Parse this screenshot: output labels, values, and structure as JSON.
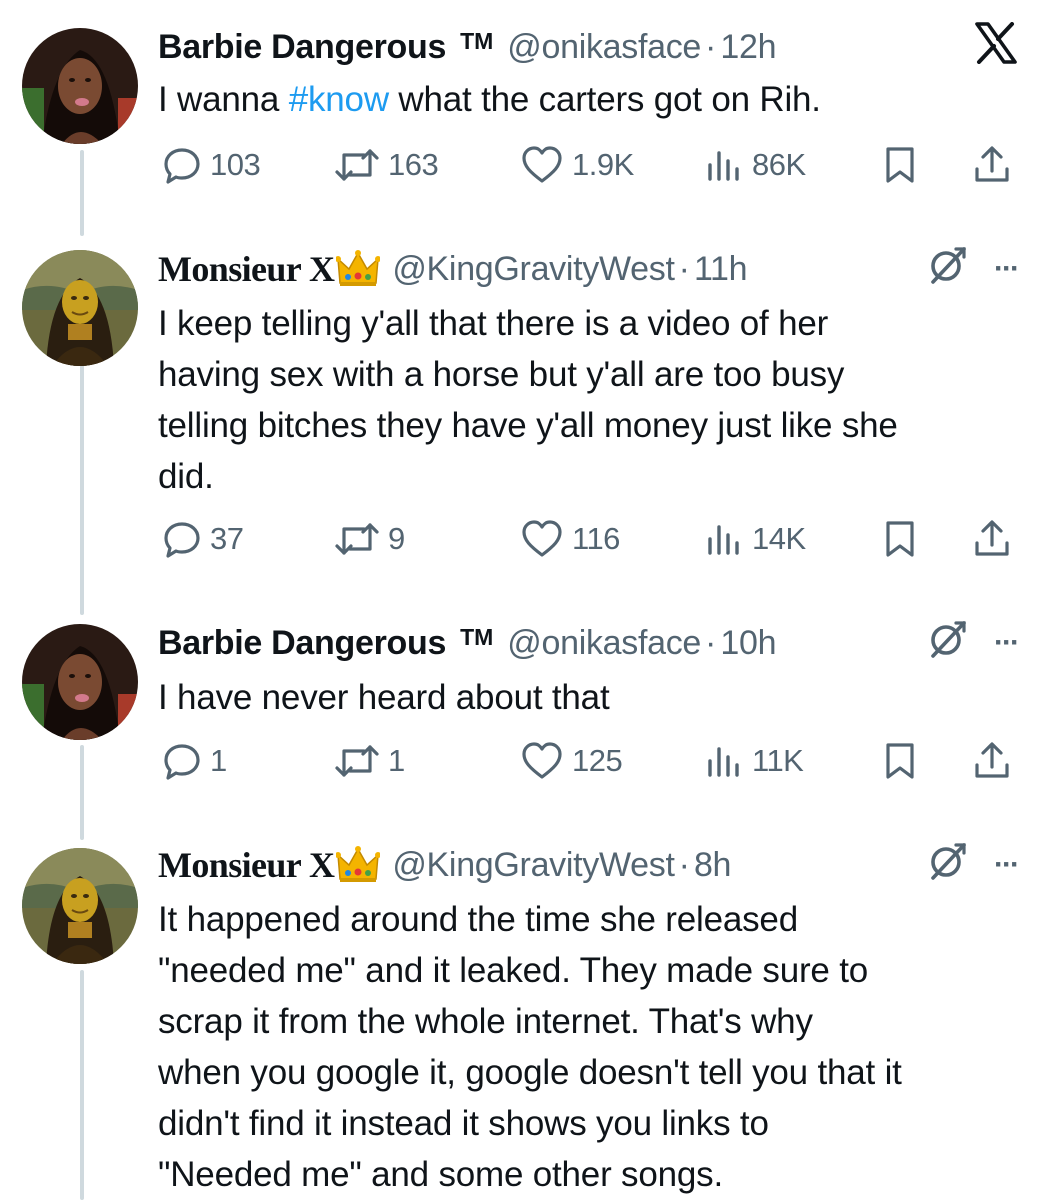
{
  "tweets": [
    {
      "name": "Barbie Dangerous",
      "badge": "TM",
      "handle": "@onikasface",
      "separator": "·",
      "time": "12h",
      "text_before": "I wanna ",
      "hashtag": "#know",
      "text_after": " what the carters got on Rih.",
      "replies": "103",
      "reposts": "163",
      "likes": "1.9K",
      "views": "86K"
    },
    {
      "name": "Monsieur X",
      "handle": "@KingGravityWest",
      "separator": "·",
      "time": "11h",
      "lines": [
        "I keep telling y'all that there is a video of her",
        "having sex with a horse but y'all are too busy",
        "telling bitches they have y'all money just like she",
        "did."
      ],
      "replies": "37",
      "reposts": "9",
      "likes": "116",
      "views": "14K"
    },
    {
      "name": "Barbie Dangerous",
      "badge": "TM",
      "handle": "@onikasface",
      "separator": "·",
      "time": "10h",
      "text": "I have never heard about that",
      "replies": "1",
      "reposts": "1",
      "likes": "125",
      "views": "11K"
    },
    {
      "name": "Monsieur X",
      "handle": "@KingGravityWest",
      "separator": "·",
      "time": "8h",
      "lines": [
        "It happened around the time she released",
        "\"needed me\" and it leaked. They made sure to",
        "scrap it from the whole internet. That's why",
        "when you google it, google doesn't tell you that it",
        "didn't find it instead it shows you links to",
        "\"Needed me\" and some other songs."
      ]
    }
  ],
  "more_label": "···",
  "colors": {
    "text": "#0f1419",
    "secondary": "#536471",
    "link": "#1d9bf0",
    "thread_line": "#cfd9de"
  },
  "icons": {
    "platform": "x-logo-icon",
    "reply": "reply-icon",
    "repost": "repost-icon",
    "like": "heart-icon",
    "views": "views-icon",
    "bookmark": "bookmark-icon",
    "share": "share-icon",
    "grok": "grok-icon",
    "more": "more-icon",
    "crown": "crown-emoji-icon"
  }
}
